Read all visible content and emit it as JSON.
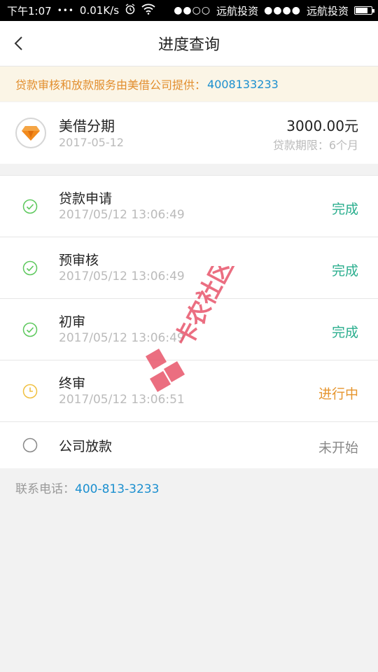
{
  "status_bar": {
    "time": "下午1:07",
    "dots": "•••",
    "speed": "0.01K/s",
    "carrier1": "远航投资",
    "carrier2": "远航投资",
    "signal1": "●●○○",
    "signal2": "●●●●"
  },
  "header": {
    "title": "进度查询"
  },
  "notice": {
    "text": "贷款审核和放款服务由美借公司提供：",
    "phone": "4008133233"
  },
  "loan": {
    "name": "美借分期",
    "date": "2017-05-12",
    "amount": "3000.00元",
    "term": "贷款期限：6个月"
  },
  "steps": [
    {
      "name": "贷款申请",
      "time": "2017/05/12 13:06:49",
      "status": "完成",
      "state": "done"
    },
    {
      "name": "预审核",
      "time": "2017/05/12 13:06:49",
      "status": "完成",
      "state": "done"
    },
    {
      "name": "初审",
      "time": "2017/05/12 13:06:49",
      "status": "完成",
      "state": "done"
    },
    {
      "name": "终审",
      "time": "2017/05/12 13:06:51",
      "status": "进行中",
      "state": "progress"
    },
    {
      "name": "公司放款",
      "time": "",
      "status": "未开始",
      "state": "pending"
    }
  ],
  "contact": {
    "label": "联系电话：",
    "phone": "400-813-3233"
  },
  "watermark": {
    "text": "卡农社区"
  },
  "colors": {
    "done": "#2aae8e",
    "progress": "#e6952e",
    "pending": "#888888",
    "link": "#1b8fcf",
    "notice": "#e28e2e"
  }
}
